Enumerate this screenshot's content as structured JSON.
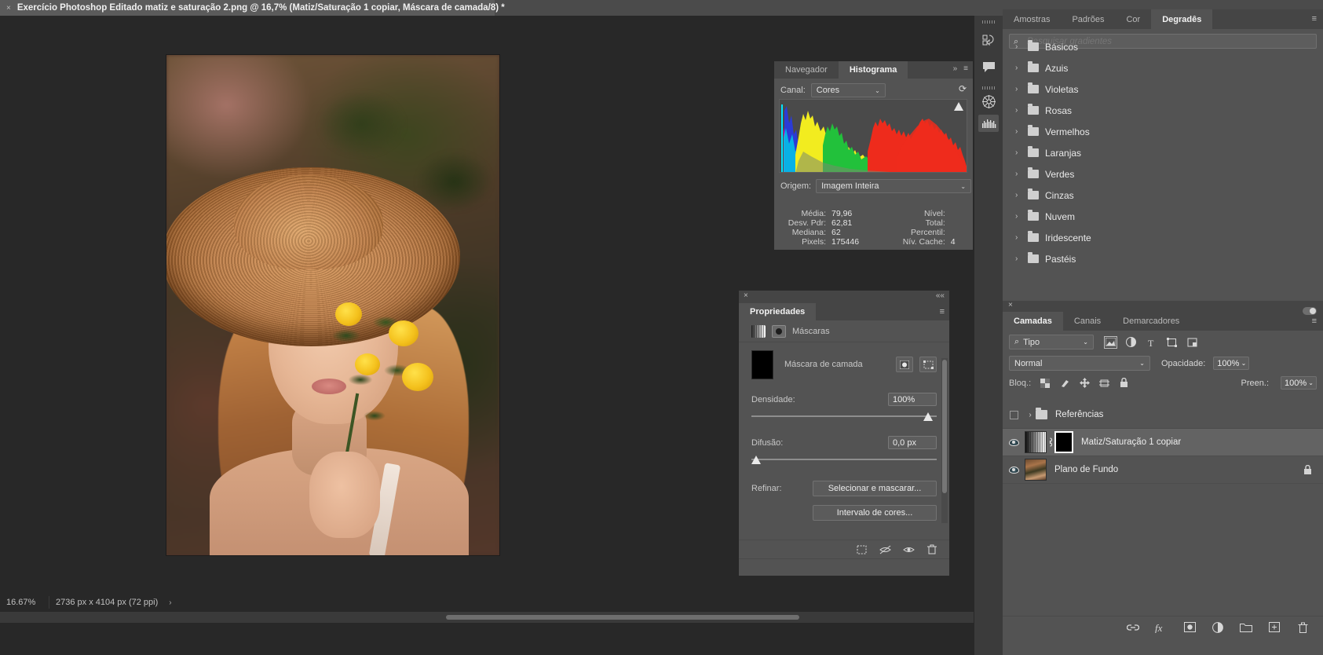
{
  "titlebar": {
    "close_glyph": "×",
    "document_title": "Exercício Photoshop Editado matiz e saturação 2.png @ 16,7% (Matiz/Saturação 1 copiar, Máscara de camada/8) *",
    "collapse_glyph": "««"
  },
  "histogram": {
    "tabs": [
      {
        "label": "Navegador",
        "active": false
      },
      {
        "label": "Histograma",
        "active": true
      }
    ],
    "expand_glyph": "»",
    "menu_glyph": "≡",
    "channel_label": "Canal:",
    "channel_value": "Cores",
    "chevron": "⌄",
    "refresh_glyph": "⟳",
    "source_label": "Origem:",
    "source_value": "Imagem Inteira",
    "stats": [
      {
        "label": "Média:",
        "value": "79,96",
        "label2": "Nível:",
        "value2": ""
      },
      {
        "label": "Desv. Pdr:",
        "value": "62,81",
        "label2": "Total:",
        "value2": ""
      },
      {
        "label": "Mediana:",
        "value": "62",
        "label2": "Percentil:",
        "value2": ""
      },
      {
        "label": "Pixels:",
        "value": "175446",
        "label2": "Nív. Cache:",
        "value2": "4"
      }
    ]
  },
  "properties": {
    "close_glyph": "×",
    "collapse_glyph": "««",
    "menu_glyph": "≡",
    "tab_label": "Propriedades",
    "section_label": "Máscaras",
    "mask_name": "Máscara de camada",
    "density_label": "Densidade:",
    "density_value": "100%",
    "feather_label": "Difusão:",
    "feather_value": "0,0 px",
    "refine_label": "Refinar:",
    "select_mask_button": "Selecionar e mascarar...",
    "color_range_button": "Intervalo de cores...",
    "footer_icons": [
      "select-mask-icon",
      "disable-mask-icon",
      "view-mask-icon",
      "delete-mask-icon"
    ]
  },
  "gradients": {
    "tabs": [
      {
        "label": "Amostras",
        "active": false
      },
      {
        "label": "Padrões",
        "active": false
      },
      {
        "label": "Cor",
        "active": false
      },
      {
        "label": "Degradês",
        "active": true
      }
    ],
    "collapse_glyph": "««",
    "menu_glyph": "≡",
    "search_placeholder": "Pesquisar gradientes",
    "search_value": "",
    "folders": [
      "Básicos",
      "Azuis",
      "Violetas",
      "Rosas",
      "Vermelhos",
      "Laranjas",
      "Verdes",
      "Cinzas",
      "Nuvem",
      "Iridescente",
      "Pastéis"
    ],
    "chevron_right": "›"
  },
  "layers": {
    "close_glyph": "×",
    "menu_glyph": "≡",
    "tabs": [
      {
        "label": "Camadas",
        "active": true
      },
      {
        "label": "Canais",
        "active": false
      },
      {
        "label": "Demarcadores",
        "active": false
      }
    ],
    "filter_label": "Tipo",
    "filter_chevron": "⌄",
    "blend_mode": "Normal",
    "opacity_label": "Opacidade:",
    "opacity_value": "100%",
    "lock_label": "Bloq.:",
    "fill_label": "Preen.:",
    "fill_value": "100%",
    "rows": [
      {
        "name": "Referências",
        "kind": "group",
        "visible": false,
        "locked": false
      },
      {
        "name": "Matiz/Saturação 1 copiar",
        "kind": "adjustment",
        "visible": true,
        "locked": false,
        "selected": true
      },
      {
        "name": "Plano de Fundo",
        "kind": "image",
        "visible": true,
        "locked": true
      }
    ],
    "lock_glyph": "🔒",
    "footer_icons": [
      "link-layers-icon",
      "layer-style-icon",
      "add-mask-icon",
      "adjustment-layer-icon",
      "new-group-icon",
      "new-layer-icon",
      "delete-layer-icon"
    ]
  },
  "statusbar": {
    "zoom": "16.67%",
    "doc_info": "2736 px x 4104 px (72 ppi)",
    "arrow_glyph": "›"
  },
  "colors": {
    "panel_bg": "#535353",
    "tab_bg": "#454545",
    "canvas_bg": "#282828",
    "titlebar_bg": "#4b4b4b",
    "text": "#e6e6e6",
    "selected_row": "#636363"
  }
}
